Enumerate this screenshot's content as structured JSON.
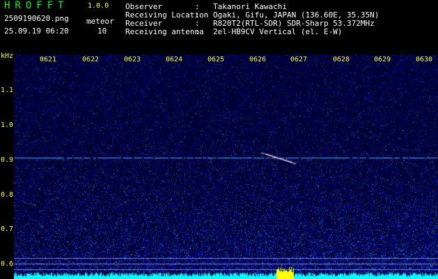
{
  "app": {
    "title": "HROFFT",
    "version": "1.0.0"
  },
  "file_name": "2509190620.png",
  "datetime": "25.09.19 06:20",
  "mode_label": "meteor",
  "count": "10",
  "info": [
    {
      "label": "Observer",
      "value": "Takanori Kawachi"
    },
    {
      "label": "Receiving Location",
      "value": "Ogaki, Gifu, JAPAN (136.60E, 35.35N)"
    },
    {
      "label": "Receiver",
      "value": "R820T2(RTL-SDR) SDR-Sharp 53.372MHz"
    },
    {
      "label": "Receiving antenna",
      "value": "2el-HB9CV Vertical (el. E-W)"
    }
  ],
  "separator": ":",
  "axis": {
    "unit": "kHz",
    "time_labels": [
      "0621",
      "0622",
      "0623",
      "0624",
      "0625",
      "0626",
      "0627",
      "0628",
      "0629",
      "0630"
    ],
    "freq_labels": [
      "1.1",
      "1.0",
      "0.9",
      "0.8",
      "0.7",
      "0.6"
    ]
  },
  "colors": {
    "title": "#00ff00",
    "axis_text": "#ffff00",
    "background": "#000033",
    "baseline": "#00ffff",
    "burst": "#ffff00"
  }
}
